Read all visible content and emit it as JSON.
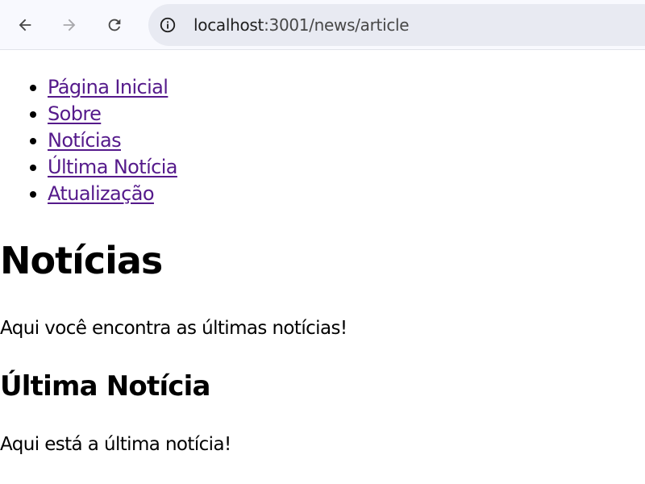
{
  "browser": {
    "url_host": "localhost",
    "url_path": ":3001/news/article",
    "icons": {
      "back": "arrow-left-icon",
      "forward": "arrow-right-icon",
      "reload": "reload-icon",
      "site_info": "info-circle-icon"
    }
  },
  "nav": {
    "items": [
      {
        "label": "Página Inicial"
      },
      {
        "label": "Sobre"
      },
      {
        "label": "Notícias"
      },
      {
        "label": "Última Notícia"
      },
      {
        "label": "Atualização"
      }
    ]
  },
  "main": {
    "title": "Notícias",
    "intro": "Aqui você encontra as últimas notícias!",
    "section_title": "Última Notícia",
    "section_text": "Aqui está a última notícia!"
  },
  "colors": {
    "link": "#551a8b",
    "text": "#000000",
    "toolbar_bg": "#f8f9fe",
    "omnibox_bg": "#e8eaf2"
  }
}
